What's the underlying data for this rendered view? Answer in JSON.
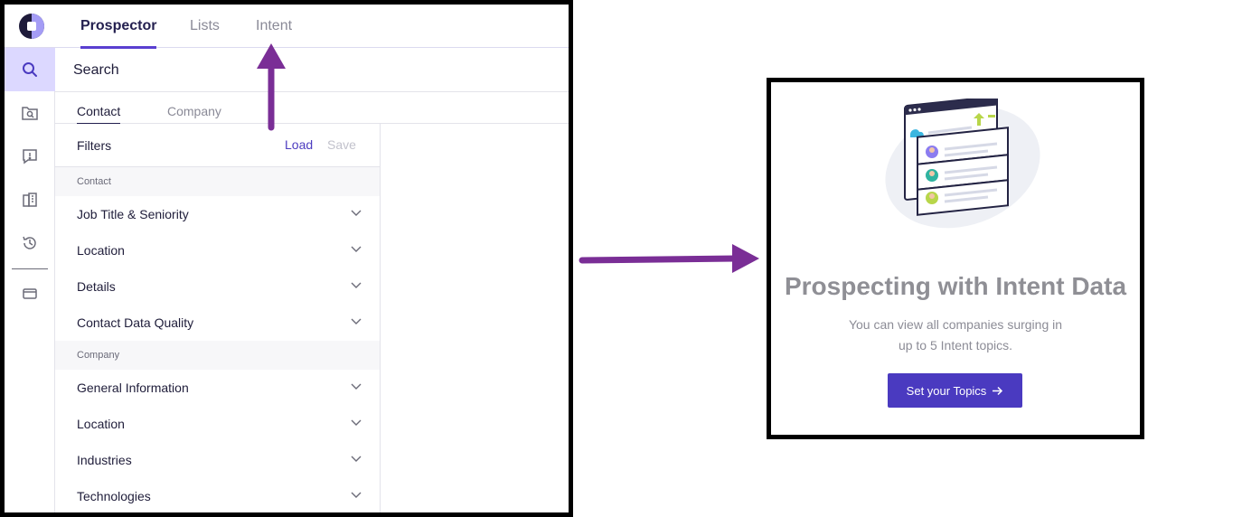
{
  "app": {
    "tabs": [
      {
        "label": "Prospector",
        "active": true
      },
      {
        "label": "Lists",
        "active": false
      },
      {
        "label": "Intent",
        "active": false
      }
    ],
    "sidebar_icons": [
      "search-icon",
      "folder-search-icon",
      "alert-message-icon",
      "buildings-icon",
      "history-icon",
      "wallet-icon"
    ],
    "search_title": "Search",
    "sub_tabs": [
      {
        "label": "Contact",
        "active": true
      },
      {
        "label": "Company",
        "active": false
      }
    ],
    "filters": {
      "title": "Filters",
      "load_label": "Load",
      "save_label": "Save",
      "sections": [
        {
          "label": "Contact",
          "items": [
            "Job Title & Seniority",
            "Location",
            "Details",
            "Contact Data Quality"
          ]
        },
        {
          "label": "Company",
          "items": [
            "General Information",
            "Location",
            "Industries",
            "Technologies"
          ]
        }
      ]
    }
  },
  "intent_card": {
    "title": "Prospecting with Intent Data",
    "description_line1": "You can view all companies surging in",
    "description_line2": "up to 5 Intent topics.",
    "button_label": "Set your Topics",
    "button_icon": "arrow-right-icon"
  },
  "colors": {
    "accent": "#4a3ac0",
    "arrow": "#7a2e96",
    "active_rail": "#dcd8ff",
    "heading_gray": "#8f8f95"
  }
}
